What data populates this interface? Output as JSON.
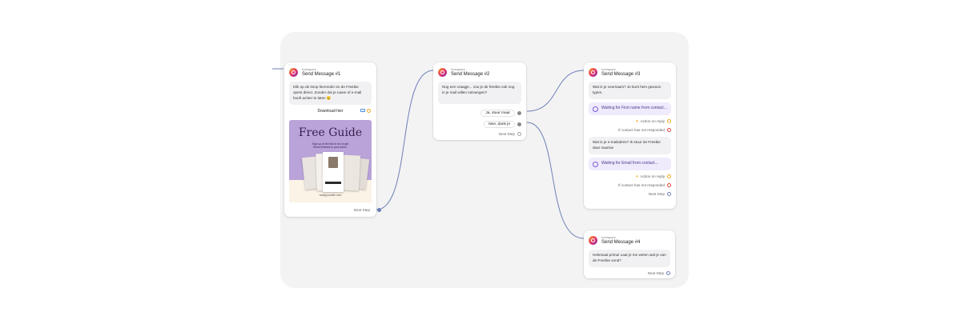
{
  "nodes": {
    "n1": {
      "platform": "Instagram",
      "title": "Send Message #1",
      "message": "Klik op de knop hieronder en de Freebie opent direct. Zonder dat je naam of e-mail hoeft achter te laten 😉",
      "button_label": "Download hier",
      "guide": {
        "title": "Free Guide",
        "subtitle": "Sign up at the link in bio to get these freebies in your inbox.",
        "url": "readyyoursite.com"
      },
      "next_step": "Next Step"
    },
    "n2": {
      "platform": "Instagram",
      "title": "Send Message #2",
      "message": "Nog een vraagje... zou je de freebie ook nog in je mail willen ontvangen?",
      "replies": [
        "Ja, stuur maar",
        "Nee, dank je"
      ],
      "next_step": "Next Step"
    },
    "n3": {
      "platform": "Instagram",
      "title": "Send Message #3",
      "q1": "Wat is je voornaam? Je kunt hem gewoon typen.",
      "wait1": "Waiting for First name from contact...",
      "q2": "Wat is je e-mailadres? Ik stuur de Freebie daar naartoe",
      "wait2": "Waiting for Email from contact...",
      "action_on_reply": "Action on reply",
      "no_response": "If contact has not responded",
      "next_step": "Next Step"
    },
    "n4": {
      "platform": "Instagram",
      "title": "Send Message #4",
      "message": "Helemaal prima! Laat je me weten wat je van de Freebie vond?",
      "next_step": "Next Step"
    }
  },
  "colors": {
    "canvas": "#f3f3f4",
    "wire": "#6d7fb5",
    "accent_purple": "#7c5cd6",
    "instagram_gradient": [
      "#f5a623",
      "#e1306c",
      "#8134af"
    ]
  }
}
